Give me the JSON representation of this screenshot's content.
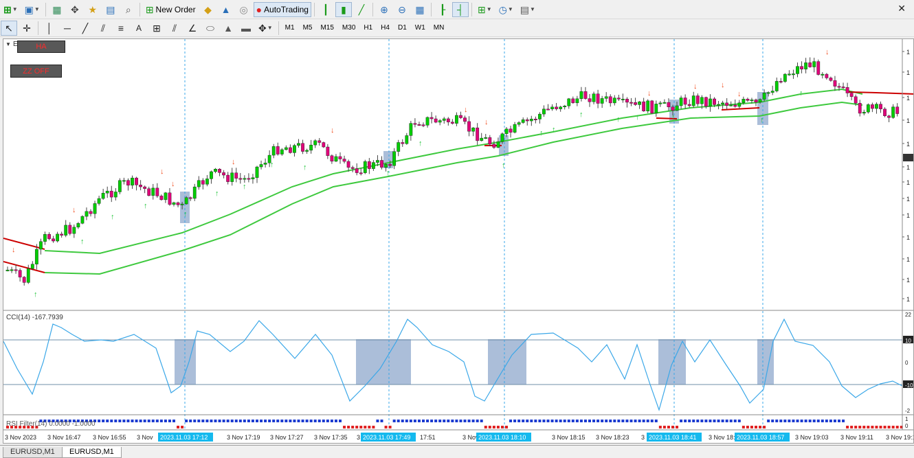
{
  "toolbar_top": {
    "new_order_label": "New Order",
    "autotrading_label": "AutoTrading"
  },
  "timeframes": [
    "M1",
    "M5",
    "M15",
    "M30",
    "H1",
    "H4",
    "D1",
    "W1",
    "MN"
  ],
  "chart": {
    "symbol_collapsed": "E",
    "buttons": {
      "ha": "HA",
      "zz": "ZZ OFF"
    },
    "cci_label": "CCI(14) -167.7939",
    "rsi_label": "RSI Filter(14) 0.0000 -1.0000",
    "time_labels": [
      "3 Nov 2023",
      "3 Nov 16:47",
      "3 Nov 16:55",
      "3 Nov",
      "3 Nov 17:19",
      "3 Nov 17:27",
      "3 Nov 17:35",
      "3",
      "17:51",
      "3 Nov 17:5",
      "3 Nov 18:15",
      "3 Nov 18:23",
      "3 Nov 18:",
      "3 Nov 18:",
      "3 Nov 19:03",
      "3 Nov 19:11",
      "3 Nov 19:1"
    ],
    "time_highlights": [
      "2023.11.03 17:12",
      "2023.11.03 17:49",
      "2023.11.03 18:10",
      "2023.11.03 18:41",
      "2023.11.03 18:57"
    ],
    "price_axis_glyph": "1",
    "cci_axis": [
      "22",
      "10",
      "0",
      "-10",
      "-2"
    ],
    "rsi_axis": [
      "1",
      "0"
    ]
  },
  "tabs": [
    "EURUSD,M1",
    "EURUSD,M1"
  ],
  "colors": {
    "bull": "#00cc00",
    "bear": "#e0007a",
    "ma_red": "#cc0000",
    "ma_green": "#3ec93e",
    "signal_box": "#8fa8cc",
    "cci_line": "#3aa7e8",
    "vline": "#3aa7e8",
    "label_bg": "#15b9ee"
  }
}
